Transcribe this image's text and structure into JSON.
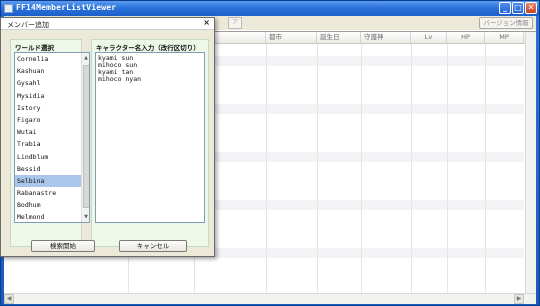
{
  "window": {
    "title": "FF14MemberListViewer",
    "caption_buttons": {
      "minimize": "_",
      "maximize": "□",
      "close": "✕"
    }
  },
  "toolbar": {
    "version_button": "バージョン情報",
    "faded_button": "ア"
  },
  "grid": {
    "columns": [
      "都市",
      "誕生日",
      "守護神",
      "Lv",
      "HP",
      "MP"
    ]
  },
  "dialog": {
    "title": "メンバー追加",
    "close": "×",
    "world_group_label": "ワールド選択",
    "worlds": [
      "Cornelia",
      "Kashuan",
      "Gysahl",
      "Mysidia",
      "Istory",
      "Figaro",
      "Wutai",
      "Trabia",
      "Lindblum",
      "Bessid",
      "Selbina",
      "Rabanastre",
      "Bodhum",
      "Melmond"
    ],
    "selected_world": "Selbina",
    "names_group_label": "キャラクター名入力（改行区切り）",
    "names": [
      "kyami sun",
      "mihoco sun",
      "kyami tan",
      "mihoco nyan"
    ],
    "search_button": "検索開始",
    "cancel_button": "キャンセル"
  },
  "colors": {
    "titlebar": "#2b72da",
    "dialog_bg": "#ece9d8",
    "group_bg": "#eef8e8",
    "selection": "#aac6ea"
  }
}
